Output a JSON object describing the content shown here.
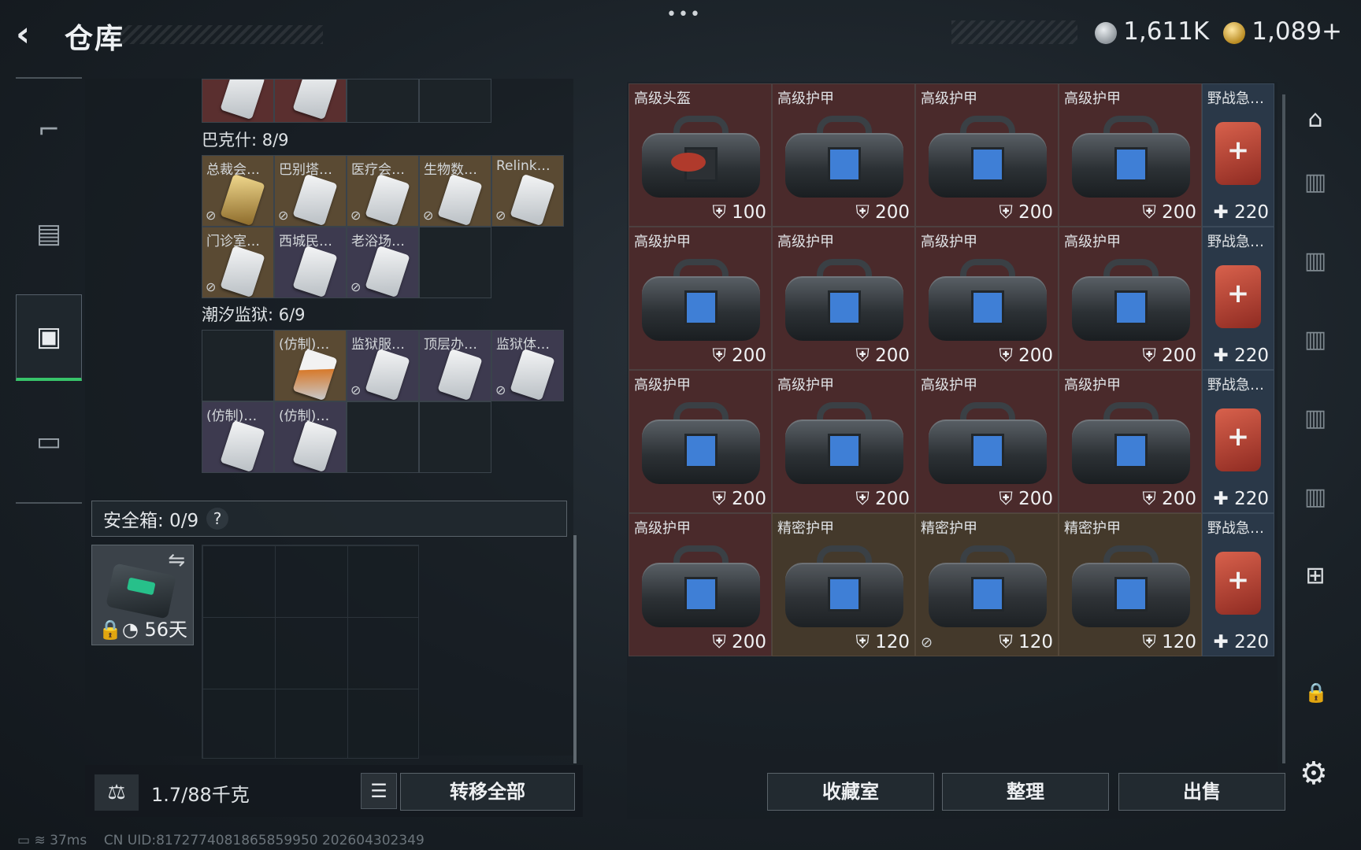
{
  "header": {
    "back_icon": "‹",
    "title": "仓库",
    "menu_dots": "•••"
  },
  "currency": [
    {
      "icon": "silver-coin-icon",
      "amount": "1,611K"
    },
    {
      "icon": "gold-coin-icon",
      "amount": "1,089+"
    }
  ],
  "left_nav": [
    {
      "icon": "gun-icon",
      "glyph": "⌐"
    },
    {
      "icon": "backpack-icon",
      "glyph": "▤"
    },
    {
      "icon": "container-icon",
      "glyph": "▣",
      "active": true
    },
    {
      "icon": "briefcase-icon",
      "glyph": "▭"
    }
  ],
  "collections": {
    "bakesh": {
      "label": "巴克什: 8/9",
      "items": [
        "总裁会…",
        "巴别塔…",
        "医疗会…",
        "生物数…",
        "Relink…",
        "门诊室…",
        "西城民…",
        "老浴场…"
      ]
    },
    "prison": {
      "label": "潮汐监狱: 6/9",
      "items": [
        "(仿制)…",
        "监狱服…",
        "顶层办…",
        "监狱体…",
        "(仿制)…",
        "(仿制)…"
      ]
    }
  },
  "safe_box": {
    "label": "安全箱: 0/9",
    "help": "?",
    "duration": "56天",
    "swap_icon": "⇋"
  },
  "bottom_left": {
    "weight": "1.7/88千克",
    "list_icon": "☰",
    "transfer_all": "转移全部"
  },
  "stash": {
    "rows": [
      [
        {
          "name": "高级头盔",
          "value": "100",
          "kind": "helmet"
        },
        {
          "name": "高级护甲",
          "value": "200",
          "kind": "armor"
        },
        {
          "name": "高级护甲",
          "value": "200",
          "kind": "armor"
        },
        {
          "name": "高级护甲",
          "value": "200",
          "kind": "armor"
        },
        {
          "name": "野战急…",
          "value": "220",
          "kind": "med"
        }
      ],
      [
        {
          "name": "高级护甲",
          "value": "200",
          "kind": "armor"
        },
        {
          "name": "高级护甲",
          "value": "200",
          "kind": "armor"
        },
        {
          "name": "高级护甲",
          "value": "200",
          "kind": "armor"
        },
        {
          "name": "高级护甲",
          "value": "200",
          "kind": "armor"
        },
        {
          "name": "野战急…",
          "value": "220",
          "kind": "med"
        }
      ],
      [
        {
          "name": "高级护甲",
          "value": "200",
          "kind": "armor"
        },
        {
          "name": "高级护甲",
          "value": "200",
          "kind": "armor"
        },
        {
          "name": "高级护甲",
          "value": "200",
          "kind": "armor"
        },
        {
          "name": "高级护甲",
          "value": "200",
          "kind": "armor"
        },
        {
          "name": "野战急…",
          "value": "220",
          "kind": "med"
        }
      ],
      [
        {
          "name": "高级护甲",
          "value": "200",
          "kind": "armor"
        },
        {
          "name": "精密护甲",
          "value": "120",
          "kind": "armor2"
        },
        {
          "name": "精密护甲",
          "value": "120",
          "kind": "armor2"
        },
        {
          "name": "精密护甲",
          "value": "120",
          "kind": "armor2"
        },
        {
          "name": "野战急…",
          "value": "220",
          "kind": "med"
        }
      ]
    ]
  },
  "actions": {
    "collection_room": "收藏室",
    "organize": "整理",
    "sell": "出售"
  },
  "status_bar": {
    "ping": "37ms",
    "uid": "CN UID:8172774081865859950 202604302349"
  },
  "colors": {
    "accent_green": "#38c46a",
    "item_red": "#4a2a2b",
    "item_gold": "#44392b"
  }
}
